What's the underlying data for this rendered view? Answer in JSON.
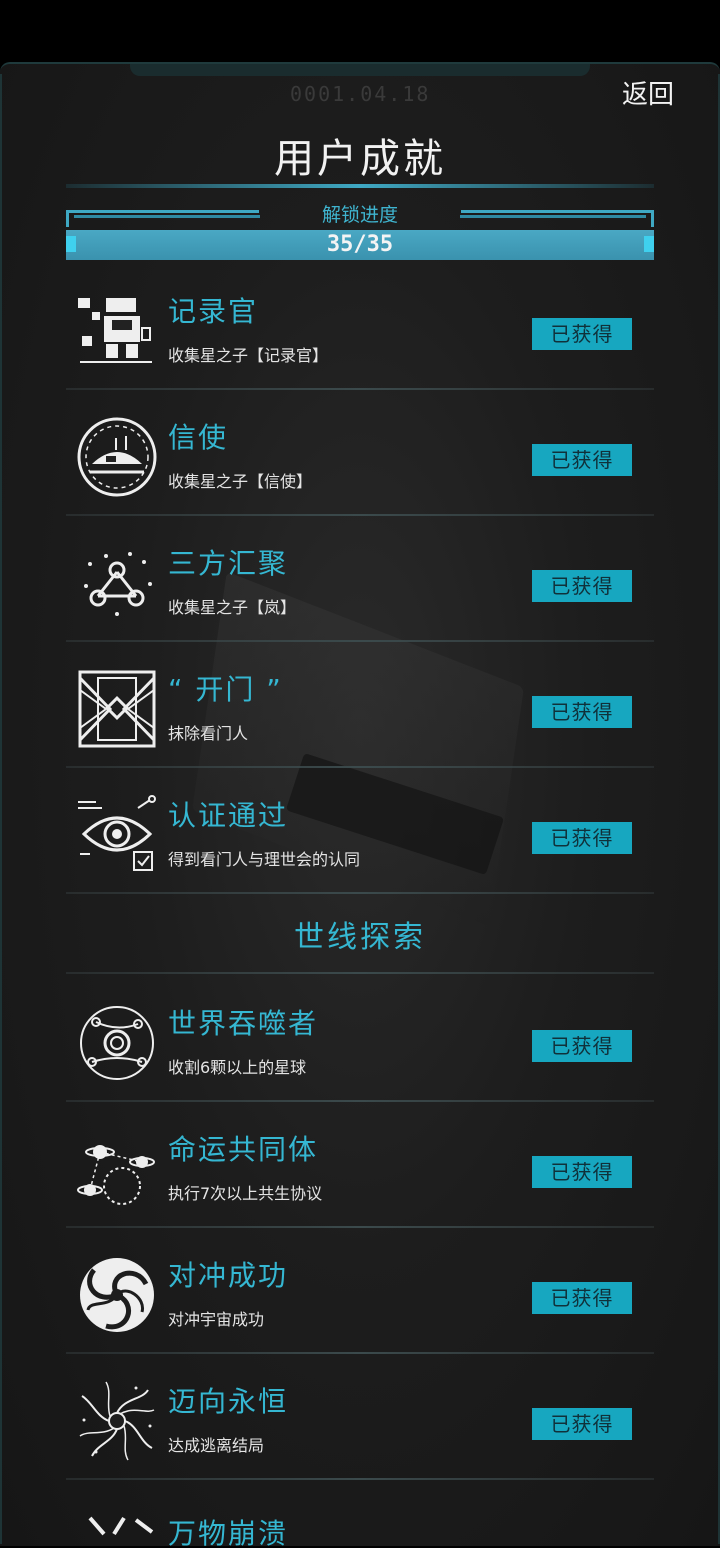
{
  "header": {
    "stamp": "0001.04.18",
    "back_label": "返回",
    "title": "用户成就"
  },
  "progress": {
    "label": "解锁进度",
    "text": "35/35",
    "unlocked": 35,
    "total": 35
  },
  "achievements": [
    {
      "name": "记录官",
      "desc": "收集星之子【记录官】",
      "status": "已获得",
      "icon": "robot-archivist-icon"
    },
    {
      "name": "信使",
      "desc": "收集星之子【信使】",
      "status": "已获得",
      "icon": "ship-in-circle-icon"
    },
    {
      "name": "三方汇聚",
      "desc": "收集星之子【岚】",
      "status": "已获得",
      "icon": "three-nodes-icon"
    },
    {
      "name": "“ 开门 ”",
      "desc": "抹除看门人",
      "status": "已获得",
      "icon": "gate-icon"
    },
    {
      "name": "认证通过",
      "desc": "得到看门人与理世会的认同",
      "status": "已获得",
      "icon": "eye-verify-icon"
    }
  ],
  "section2": {
    "title": "世线探索",
    "items": [
      {
        "name": "世界吞噬者",
        "desc": "收割6颗以上的星球",
        "status": "已获得",
        "icon": "planet-orbit-icon"
      },
      {
        "name": "命运共同体",
        "desc": "执行7次以上共生协议",
        "status": "已获得",
        "icon": "linked-planets-icon"
      },
      {
        "name": "对冲成功",
        "desc": "对冲宇宙成功",
        "status": "已获得",
        "icon": "vortex-icon"
      },
      {
        "name": "迈向永恒",
        "desc": "达成逃离结局",
        "status": "已获得",
        "icon": "swirl-icon"
      }
    ],
    "partial_name": "万物崩溃"
  },
  "colors": {
    "accent": "#35b7d2",
    "button": "#17a7c0",
    "panel": "#1d1d1d"
  }
}
